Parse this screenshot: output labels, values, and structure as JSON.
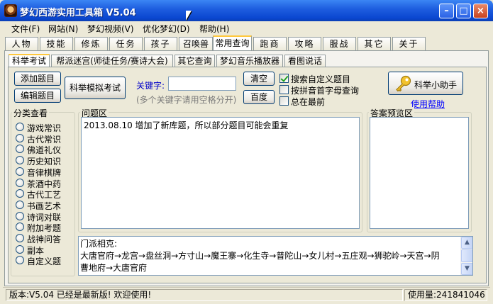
{
  "window": {
    "title": "梦幻西游实用工具箱 V5.04",
    "minimize": "–",
    "maximize": "□",
    "close": "×"
  },
  "menu": [
    "文件(F)",
    "网站(N)",
    "梦幻视频(V)",
    "优化梦幻(D)",
    "帮助(H)"
  ],
  "main_tabs": [
    "人物",
    "技能",
    "修炼",
    "任务",
    "孩子",
    "召唤兽",
    "常用查询",
    "跑商",
    "攻略",
    "服战",
    "其它",
    "关于"
  ],
  "sub_tabs": [
    "科举考试",
    "帮派迷宫(师徒任务/赛诗大会)",
    "其它查询",
    "梦幻音乐播放器",
    "看图说话"
  ],
  "buttons": {
    "add": "添加题目",
    "edit": "编辑题目",
    "mock_exam": "科举模拟考试",
    "clear": "清空",
    "baidu": "百度",
    "helper": "科举小助手"
  },
  "keyword": {
    "label": "关键字:",
    "value": "",
    "hint": "(多个关键字请用空格分开)"
  },
  "options": [
    {
      "label": "搜索自定义题目",
      "checked": true
    },
    {
      "label": "按拼音首字母查询",
      "checked": false
    },
    {
      "label": "总在最前",
      "checked": false
    }
  ],
  "help_link": "使用帮助",
  "category": {
    "title": "分类查看",
    "items": [
      "游戏常识",
      "古代常识",
      "佛道礼仪",
      "历史知识",
      "音律棋牌",
      "茶酒中药",
      "古代工艺",
      "书画艺术",
      "诗词对联",
      "附加考题",
      "战神问答",
      "副本",
      "自定义题"
    ]
  },
  "question_area": {
    "title": "问题区",
    "text": "2013.08.10 增加了新库题，所以部分题目可能会重复"
  },
  "answer_area": {
    "title": "答案预览区",
    "text": ""
  },
  "info": {
    "line1": "门派相克:",
    "line2": "大唐官府→龙宫→盘丝洞→方寸山→魔王寨→化生寺→普陀山→女儿村→五庄观→狮驼岭→天宫→阴",
    "line3": "曹地府→大唐官府"
  },
  "status": {
    "left": "版本:V5.04 已经是最新版! 欢迎使用!",
    "right": "使用量:241841046"
  }
}
